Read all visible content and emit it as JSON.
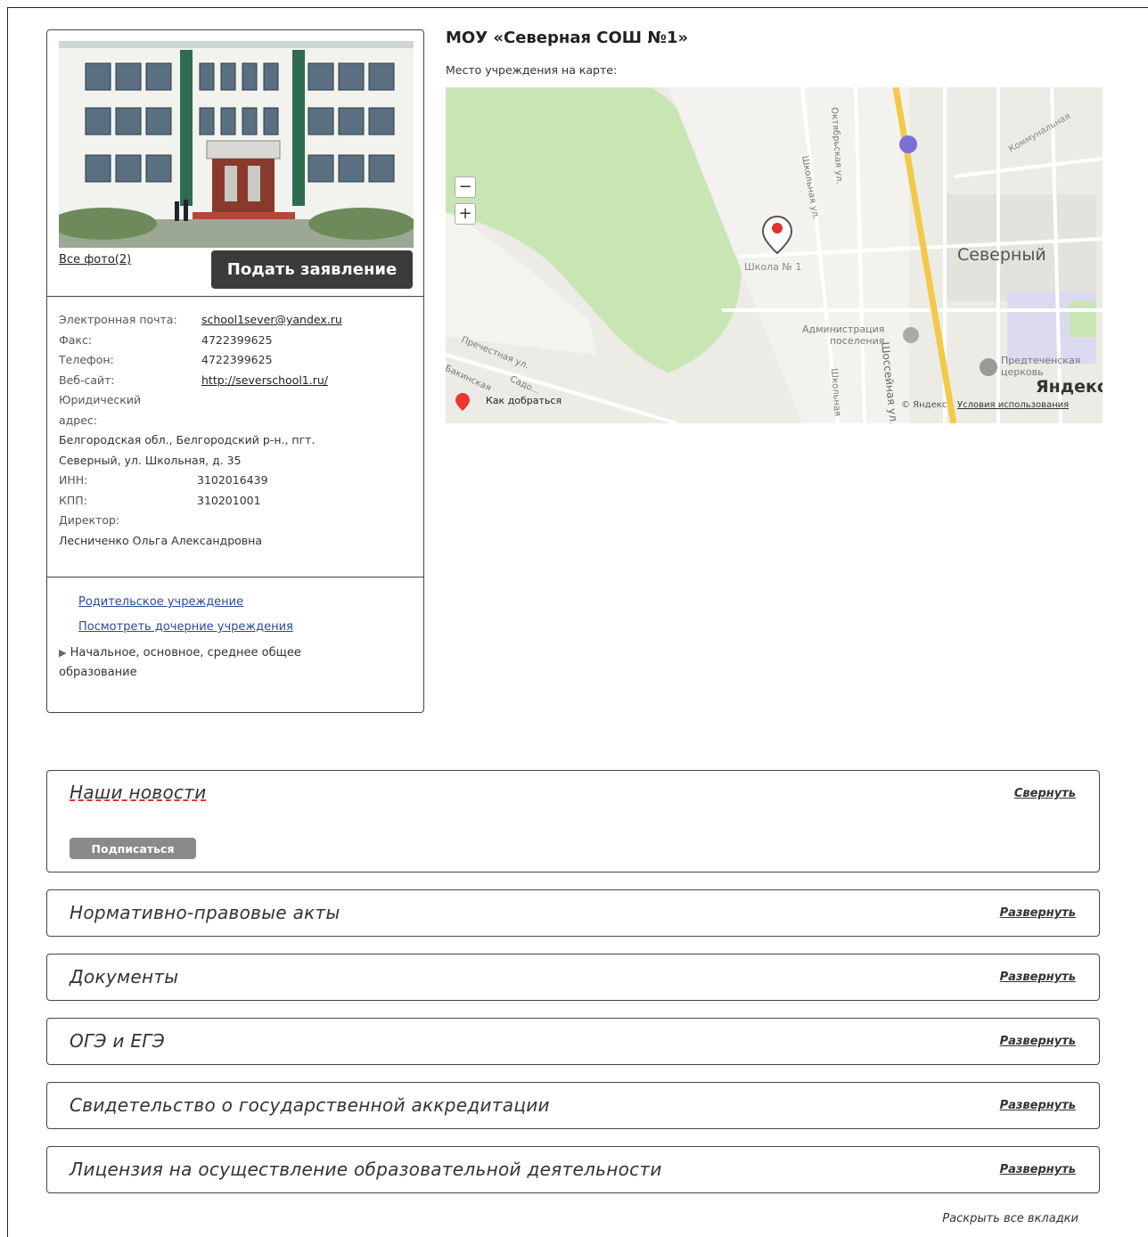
{
  "school": {
    "title": "МОУ «Северная СОШ №1»",
    "map_label": "Место учреждения на карте:",
    "all_photos": "Все фото(2)",
    "apply_button": "Подать заявление"
  },
  "contacts": {
    "email_label": "Электронная почта:",
    "email": "school1sever@yandex.ru",
    "fax_label": "Факс:",
    "fax": "4722399625",
    "phone_label": "Телефон:",
    "phone": "4722399625",
    "site_label": "Веб-сайт:",
    "site": "http://severschool1.ru/",
    "legal_label_1": "Юридический",
    "legal_label_2": "адрес:",
    "address_1": "Белгородская обл., Белгородский р-н., пгт.",
    "address_2": "Северный, ул. Школьная, д. 35",
    "inn_label": "ИНН:",
    "inn": "3102016439",
    "kpp_label": "КПП:",
    "kpp": "310201001",
    "director_label": "Директор:",
    "director": "Лесниченко Ольга Александровна"
  },
  "links": {
    "parent": "Родительское учреждение",
    "children": "Посмотреть дочерние учреждения",
    "category_1": "Начальное, основное, среднее общее",
    "category_2": "образование"
  },
  "map": {
    "zoom_out": "−",
    "zoom_in": "+",
    "directions": "Как добраться",
    "place_big": "Северный",
    "school_marker": "Школа № 1",
    "admin_1": "Администрация",
    "admin_2": "поселения",
    "church_1": "Предтеченская",
    "church_2": "церковь",
    "street_highway": "Шоссейная ул.",
    "street_oct": "Октябрьская ул.",
    "street_school": "Школьная ул.",
    "street_school_2": "Школьная",
    "street_prestn": "Пречестная ул.",
    "street_comm": "Коммунальная",
    "street_bak": "Бакинская",
    "street_sad": "Садо...",
    "yandex_logo": "Яндекс",
    "copyright": "© Яндекс",
    "terms": "Условия использования"
  },
  "panels": [
    {
      "title": "Наши новости",
      "toggle": "Свернуть",
      "subscribe": "Подписаться"
    },
    {
      "title": "Нормативно-правовые акты",
      "toggle": "Развернуть"
    },
    {
      "title": "Документы",
      "toggle": "Развернуть"
    },
    {
      "title": "ОГЭ и ЕГЭ",
      "toggle": "Развернуть"
    },
    {
      "title": "Свидетельство о государственной аккредитации",
      "toggle": "Развернуть"
    },
    {
      "title": "Лицензия на осуществление образовательной деятельности",
      "toggle": "Развернуть"
    }
  ],
  "expand_all": "Раскрыть все вкладки",
  "colors": {
    "map_road": "#f3c94a",
    "map_park": "#c8e6b4",
    "button_dark": "#3b3b3b"
  }
}
